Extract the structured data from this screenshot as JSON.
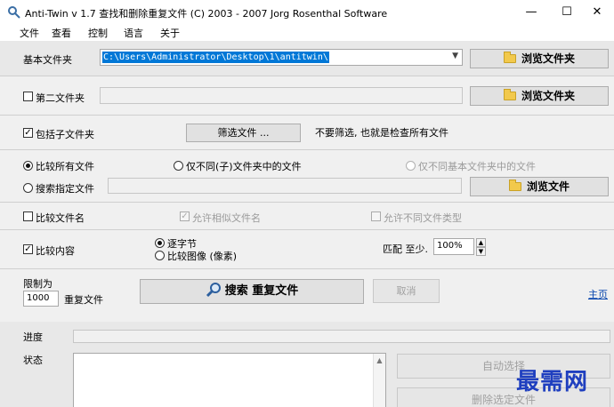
{
  "window": {
    "title": "Anti-Twin   v 1.7   查找和删除重复文件  (C) 2003 - 2007  Jorg Rosenthal Software",
    "minimize": "—",
    "maximize": "☐",
    "close": "✕"
  },
  "menu": [
    "文件",
    "查看",
    "控制",
    "语言",
    "关于"
  ],
  "base_folder": {
    "label": "基本文件夹",
    "path": "C:\\Users\\Administrator\\Desktop\\1\\antitwin\\",
    "browse": "浏览文件夹"
  },
  "second_folder": {
    "label": "第二文件夹",
    "browse": "浏览文件夹"
  },
  "subfolders": {
    "label": "包括子文件夹",
    "filter_button": "筛选文件 ...",
    "filter_note": "不要筛选, 也就是检查所有文件"
  },
  "scope": {
    "all": "比较所有文件",
    "diff_sub": "仅不同(子)文件夹中的文件",
    "diff_base": "仅不同基本文件夹中的文件",
    "search": "搜索指定文件",
    "browse_file": "浏览文件"
  },
  "names": {
    "label": "比较文件名",
    "similar": "允许相似文件名",
    "types": "允许不同文件类型"
  },
  "content": {
    "label": "比较内容",
    "bytewise": "逐字节",
    "image": "比较图像  (像素)",
    "match_label": "匹配 至少.",
    "match_value": "100%"
  },
  "limit": {
    "label": "限制为",
    "value": "1000",
    "suffix": "重复文件"
  },
  "actions": {
    "search": "搜索 重复文件",
    "cancel": "取消",
    "home": "主页"
  },
  "progress": {
    "label": "进度",
    "percent": 0
  },
  "status": {
    "label": "状态",
    "auto_select": "自动选择",
    "delete_selected": "删除选定文件"
  },
  "watermark": "最需网",
  "colors": {
    "selection": "#0078d7",
    "link": "#0645ad",
    "watermark": "#1f3fbf"
  }
}
